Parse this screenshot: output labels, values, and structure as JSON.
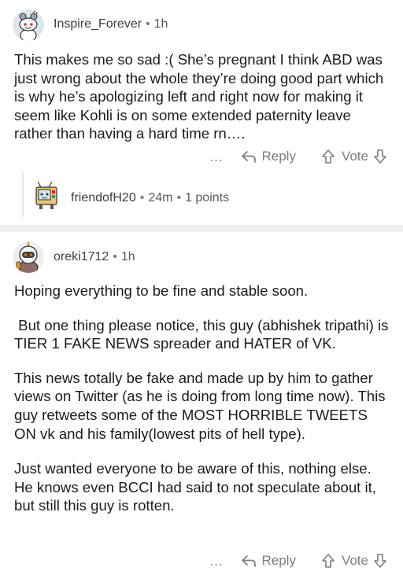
{
  "comments": [
    {
      "username": "Inspire_Forever",
      "age": "1h",
      "paragraphs": [
        "This makes me so sad :( She’s pregnant I think ABD was just wrong about the whole they’re doing good part which is why he’s apologizing left and right now for making it seem like Kohli is on some extended paternity leave rather than having a hard time rn…."
      ],
      "actions": {
        "more": "…",
        "reply": "Reply",
        "vote": "Vote"
      },
      "replies": [
        {
          "username": "friendofH20",
          "age": "24m",
          "points": "1 points"
        }
      ]
    },
    {
      "username": "oreki1712",
      "age": "1h",
      "paragraphs": [
        "Hoping everything to be fine and stable soon.",
        " But one thing please notice, this guy (abhishek tripathi) is TIER 1 FAKE NEWS spreader and HATER of VK.",
        "This news totally be fake and made up by him to gather views on Twitter (as he is doing from long time now). This guy retweets some of the MOST HORRIBLE TWEETS ON vk and his family(lowest pits of hell type).",
        "Just wanted everyone to be aware of this, nothing else.  He knows even BCCI had said to not speculate about it, but still this guy is rotten."
      ],
      "actions": {
        "more": "…",
        "reply": "Reply",
        "vote": "Vote"
      }
    }
  ],
  "separator": "•",
  "colors": {
    "meta": "#55595c",
    "action": "#7c7c7c",
    "divider": "#efefef",
    "thread_line": "#e6e6e6"
  },
  "icons": [
    "snoo-avatar",
    "tv-robot-avatar",
    "astronaut-avatar",
    "reply-arrow-icon",
    "upvote-icon",
    "downvote-icon"
  ]
}
